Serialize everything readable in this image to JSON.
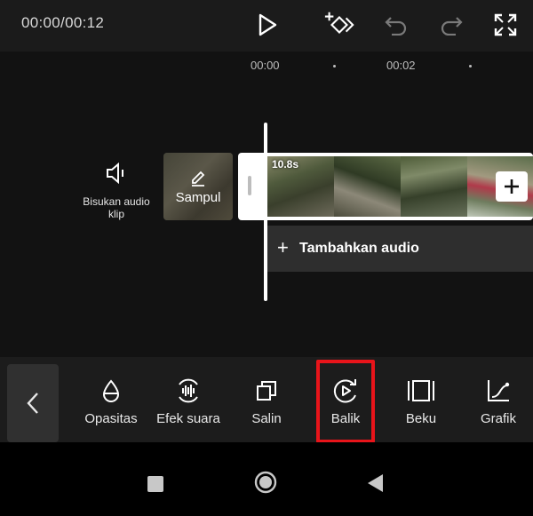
{
  "topbar": {
    "time": "00:00/00:12",
    "icons": [
      "play-icon",
      "keyframe-icon",
      "undo-icon",
      "redo-icon",
      "fullscreen-icon"
    ]
  },
  "ruler": {
    "labels": [
      "00:00",
      "00:02"
    ]
  },
  "timeline": {
    "mute_label": "Bisukan audio klip",
    "cover_label": "Sampul",
    "clip_duration": "10.8s",
    "add_audio_plus": "+",
    "add_audio_label": "Tambahkan audio"
  },
  "toolbar": {
    "items": [
      {
        "label": "Opasitas",
        "icon": "opacity-icon"
      },
      {
        "label": "Efek suara",
        "icon": "sound-effect-icon"
      },
      {
        "label": "Salin",
        "icon": "copy-icon"
      },
      {
        "label": "Balik",
        "icon": "reverse-icon"
      },
      {
        "label": "Beku",
        "icon": "freeze-icon"
      },
      {
        "label": "Grafik",
        "icon": "graph-icon"
      }
    ],
    "highlighted": "Balik"
  },
  "colors": {
    "highlight": "#e8141a",
    "background": "#121212",
    "panel": "#1c1c1c"
  }
}
